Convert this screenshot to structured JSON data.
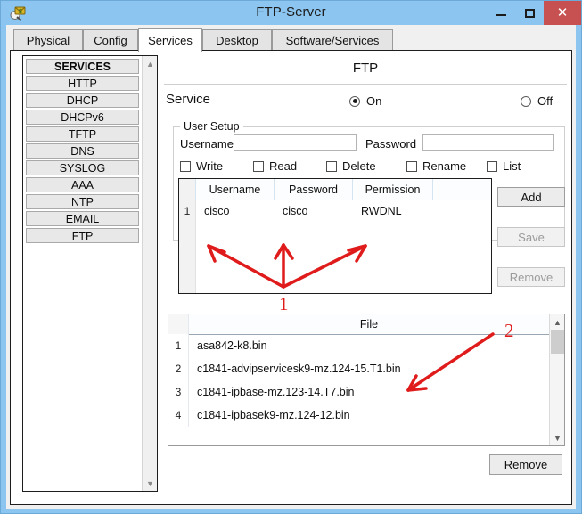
{
  "window": {
    "title": "FTP-Server",
    "icon": "ftp-server-icon",
    "minimize_label": "–",
    "maximize_label": "□",
    "close_label": "✕"
  },
  "tabs": [
    {
      "label": "Physical",
      "active": false
    },
    {
      "label": "Config",
      "active": false
    },
    {
      "label": "Services",
      "active": true
    },
    {
      "label": "Desktop",
      "active": false
    },
    {
      "label": "Software/Services",
      "active": false
    }
  ],
  "sidebar": {
    "items": [
      {
        "label": "SERVICES",
        "header": true
      },
      {
        "label": "HTTP",
        "header": false
      },
      {
        "label": "DHCP",
        "header": false
      },
      {
        "label": "DHCPv6",
        "header": false
      },
      {
        "label": "TFTP",
        "header": false
      },
      {
        "label": "DNS",
        "header": false
      },
      {
        "label": "SYSLOG",
        "header": false
      },
      {
        "label": "AAA",
        "header": false
      },
      {
        "label": "NTP",
        "header": false
      },
      {
        "label": "EMAIL",
        "header": false
      },
      {
        "label": "FTP",
        "header": false
      }
    ],
    "scroll_up": "▲",
    "scroll_down": "▼"
  },
  "panel": {
    "title": "FTP",
    "service_label": "Service",
    "service_on_label": "On",
    "service_off_label": "Off",
    "service_state": "On"
  },
  "user_setup": {
    "legend": "User Setup",
    "username_label": "Username",
    "username_value": "",
    "username_placeholder": "",
    "password_label": "Password",
    "password_value": "",
    "password_placeholder": "",
    "permissions": [
      {
        "label": "Write",
        "checked": false
      },
      {
        "label": "Read",
        "checked": false
      },
      {
        "label": "Delete",
        "checked": false
      },
      {
        "label": "Rename",
        "checked": false
      },
      {
        "label": "List",
        "checked": false
      }
    ]
  },
  "user_table": {
    "columns": [
      "Username",
      "Password",
      "Permission",
      ""
    ],
    "rows": [
      {
        "num": "1",
        "username": "cisco",
        "password": "cisco",
        "permission": "RWDNL"
      }
    ]
  },
  "actions": {
    "add_label": "Add",
    "save_label": "Save",
    "remove_label": "Remove",
    "add_enabled": true,
    "save_enabled": false,
    "remove_enabled": false
  },
  "file_list": {
    "header": "File",
    "rows": [
      {
        "num": "1",
        "name": "asa842-k8.bin"
      },
      {
        "num": "2",
        "name": "c1841-advipservicesk9-mz.124-15.T1.bin"
      },
      {
        "num": "3",
        "name": "c1841-ipbase-mz.123-14.T7.bin"
      },
      {
        "num": "4",
        "name": "c1841-ipbasek9-mz.124-12.bin"
      }
    ],
    "scroll_up": "▲",
    "scroll_down": "▼",
    "remove_label": "Remove"
  },
  "annotations": [
    {
      "id": "1",
      "label": "1",
      "color": "#e01b1b"
    },
    {
      "id": "2",
      "label": "2",
      "color": "#e01b1b"
    }
  ],
  "colors": {
    "titlebar": "#8cc6f0",
    "close_button": "#c75050",
    "annotation": "#e01b1b",
    "button_face": "#ececec"
  }
}
